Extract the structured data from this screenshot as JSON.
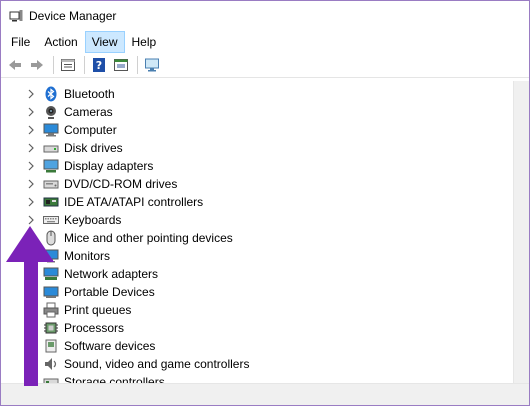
{
  "window": {
    "title": "Device Manager"
  },
  "menu": [
    {
      "label": "File",
      "active": false
    },
    {
      "label": "Action",
      "active": false
    },
    {
      "label": "View",
      "active": true
    },
    {
      "label": "Help",
      "active": false
    }
  ],
  "toolbar": {
    "icons": [
      "back-arrow-icon",
      "forward-arrow-icon",
      "properties-icon",
      "help-icon",
      "view-icon",
      "monitor-scan-icon"
    ]
  },
  "tree": {
    "items": [
      {
        "label": "Bluetooth",
        "icon": "bluetooth-icon",
        "expandable": true
      },
      {
        "label": "Cameras",
        "icon": "camera-icon",
        "expandable": true
      },
      {
        "label": "Computer",
        "icon": "computer-icon",
        "expandable": true
      },
      {
        "label": "Disk drives",
        "icon": "disk-drive-icon",
        "expandable": true
      },
      {
        "label": "Display adapters",
        "icon": "display-adapter-icon",
        "expandable": true
      },
      {
        "label": "DVD/CD-ROM drives",
        "icon": "dvd-drive-icon",
        "expandable": true
      },
      {
        "label": "IDE ATA/ATAPI controllers",
        "icon": "ide-controller-icon",
        "expandable": true
      },
      {
        "label": "Keyboards",
        "icon": "keyboard-icon",
        "expandable": true
      },
      {
        "label": "Mice and other pointing devices",
        "icon": "mouse-icon",
        "expandable": true
      },
      {
        "label": "Monitors",
        "icon": "monitor-icon",
        "expandable": true
      },
      {
        "label": "Network adapters",
        "icon": "network-adapter-icon",
        "expandable": true
      },
      {
        "label": "Portable Devices",
        "icon": "portable-device-icon",
        "expandable": true
      },
      {
        "label": "Print queues",
        "icon": "printer-icon",
        "expandable": true
      },
      {
        "label": "Processors",
        "icon": "processor-icon",
        "expandable": true
      },
      {
        "label": "Software devices",
        "icon": "software-device-icon",
        "expandable": true
      },
      {
        "label": "Sound, video and game controllers",
        "icon": "sound-icon",
        "expandable": true
      },
      {
        "label": "Storage controllers",
        "icon": "storage-controller-icon",
        "expandable": true
      }
    ]
  },
  "colors": {
    "annotation_arrow": "#7b22b8",
    "selection": "#cce8ff"
  }
}
